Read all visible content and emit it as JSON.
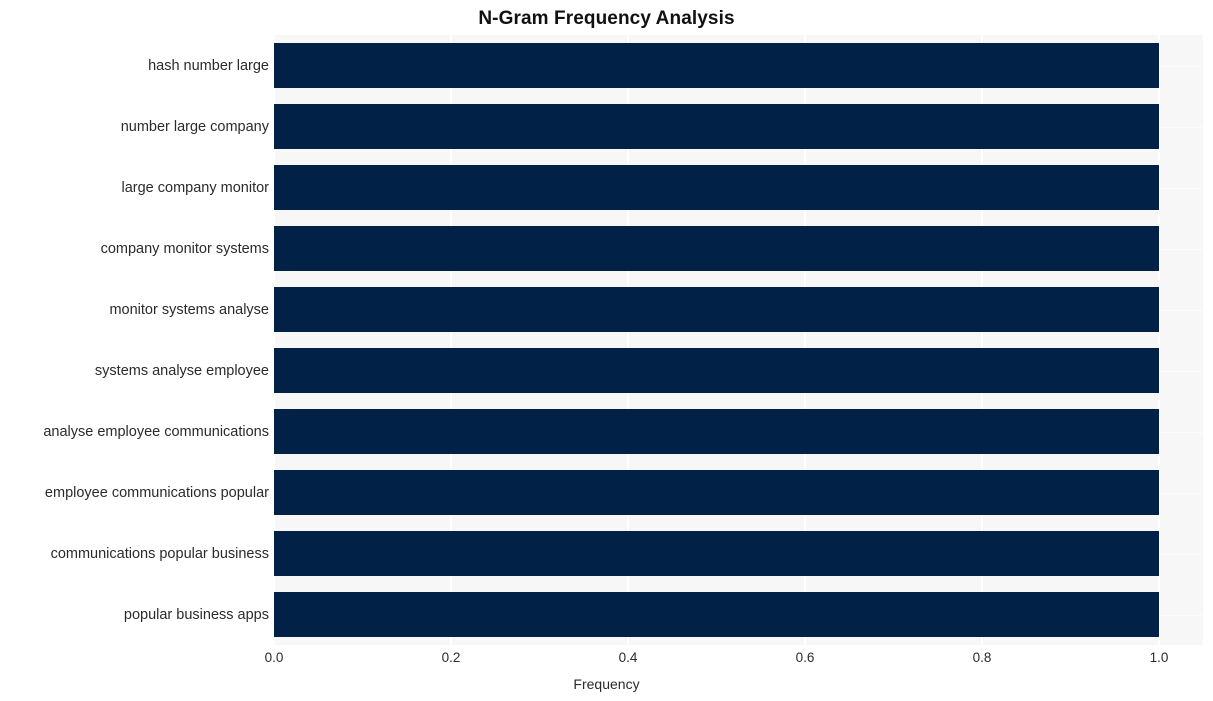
{
  "chart_data": {
    "type": "bar",
    "orientation": "horizontal",
    "title": "N-Gram Frequency Analysis",
    "xlabel": "Frequency",
    "ylabel": "",
    "xlim": [
      0.0,
      1.0
    ],
    "xticks": [
      "0.0",
      "0.2",
      "0.4",
      "0.6",
      "0.8",
      "1.0"
    ],
    "xtick_values": [
      0.0,
      0.2,
      0.4,
      0.6,
      0.8,
      1.0
    ],
    "grid": true,
    "legend": false,
    "bar_color": "#012147",
    "plot_background": "#f7f7f7",
    "gridline_color": "#ffffff",
    "categories": [
      "hash number large",
      "number large company",
      "large company monitor",
      "company monitor systems",
      "monitor systems analyse",
      "systems analyse employee",
      "analyse employee communications",
      "employee communications popular",
      "communications popular business",
      "popular business apps"
    ],
    "values": [
      1.0,
      1.0,
      1.0,
      1.0,
      1.0,
      1.0,
      1.0,
      1.0,
      1.0,
      1.0
    ]
  }
}
